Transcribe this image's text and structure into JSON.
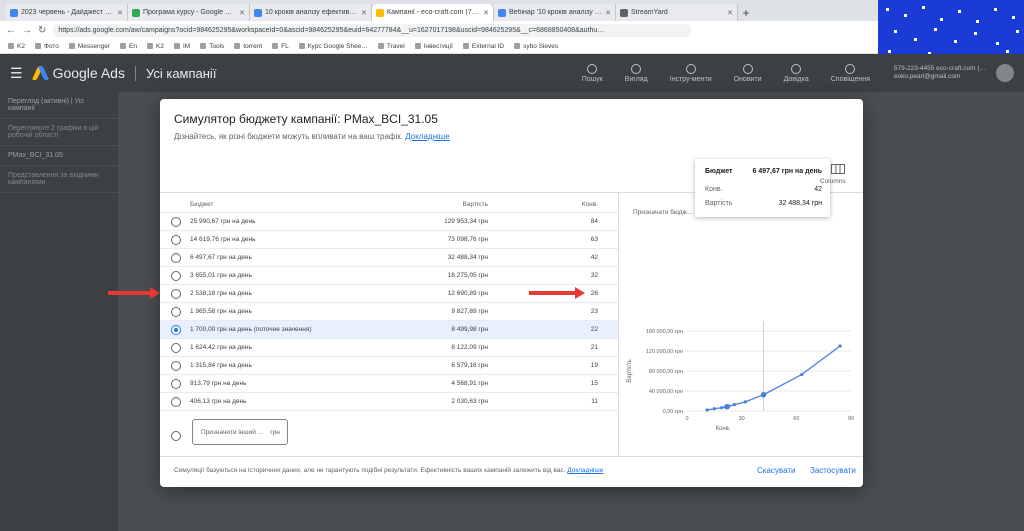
{
  "browser": {
    "tabs": [
      {
        "label": "2023 червень - Дайджест - …",
        "color": "#4285f4"
      },
      {
        "label": "Програма курсу - Google Di…",
        "color": "#34a853"
      },
      {
        "label": "10 кроків аналізу ефективно…",
        "color": "#4285f4"
      },
      {
        "label": "Кампанії - eco-craft.com (77…",
        "color": "#fbbc04"
      },
      {
        "label": "Вебінар '10 кроків аналізу е…",
        "color": "#4285f4"
      },
      {
        "label": "StreamYard",
        "color": "#5f6368"
      }
    ],
    "url": "https://ads.google.com/aw/campaigns?ocid=984625295&workspaceId=0&ascid=984625295&euid=64277784&__u=1627017198&uscid=984625295&__c=6868850408&authu…",
    "bookmarks": [
      "K2",
      "Фото",
      "Messenger",
      "En",
      "K2",
      "IM",
      "Tools",
      "torrent",
      "FL",
      "Курс Google Shee…",
      "Travel",
      "Інвестиції",
      "External ID",
      "sybo Sleves"
    ]
  },
  "ads": {
    "logo": "Google Ads",
    "crumb": "Усі кампанії",
    "tools": [
      "Пошук",
      "Вигляд",
      "Інстру-менти",
      "Оновити",
      "Довідка",
      "Сповіщення"
    ],
    "account": [
      "579-223-4455 eco-craft.com (…",
      "eoko.pearl@gmail.com"
    ],
    "side": [
      "Перегляд (активні) | Усі кампанії",
      "Перегляньте 2 графіки в цій робочій області",
      "PMax_BCI_31.05",
      "Представлення за вхідними кампаніями"
    ]
  },
  "modal": {
    "title": "Симулятор бюджету кампанії: PMax_BCI_31.05",
    "subtitle": "Дізнайтесь, як різні бюджети можуть впливати на ваш трафік.",
    "subtitle_link": "Докладніше",
    "headers": {
      "budget": "Бюджет",
      "cost": "Вартість",
      "conv": "Конв."
    },
    "rows": [
      {
        "budget": "25 990,67 грн на день",
        "cost": "129 953,34 грн",
        "conv": "84"
      },
      {
        "budget": "14 619,76 грн на день",
        "cost": "73 098,76 грн",
        "conv": "63"
      },
      {
        "budget": "6 497,67 грн на день",
        "cost": "32 488,34 грн",
        "conv": "42"
      },
      {
        "budget": "3 655,01 грн на день",
        "cost": "18 275,05 грн",
        "conv": "32"
      },
      {
        "budget": "2 538,18 грн на день",
        "cost": "12 690,89 грн",
        "conv": "26"
      },
      {
        "budget": "1 965,58 грн на день",
        "cost": "9 827,89 грн",
        "conv": "23"
      },
      {
        "budget": "1 700,00 грн на день (поточне значення)",
        "cost": "8 499,98 грн",
        "conv": "22",
        "selected": true
      },
      {
        "budget": "1 624,42 грн на день",
        "cost": "8 122,09 грн",
        "conv": "21"
      },
      {
        "budget": "1 315,84 грн на день",
        "cost": "6 579,16 грн",
        "conv": "19"
      },
      {
        "budget": "913,79 грн на день",
        "cost": "4 568,91 грн",
        "conv": "15"
      },
      {
        "budget": "406,13 грн на день",
        "cost": "2 030,63 грн",
        "conv": "11"
      }
    ],
    "custom_placeholder": "Призначити інший …",
    "custom_unit": "грн",
    "chart_label": "Призначати бюдж…",
    "columns_label": "Columns",
    "tooltip": {
      "title": "Бюджет",
      "title_value": "6 497,67 грн на день",
      "conv_label": "Конв.",
      "conv_value": "42",
      "cost_label": "Вартість",
      "cost_value": "32 488,34 грн"
    },
    "footer_note": "Симуляції базуються на історичних даних, але не гарантують подібні результати. Ефективність ваших кампаній залежить від вас.",
    "footer_link": "Докладніше",
    "cancel": "Скасувати",
    "apply": "Застосувати"
  },
  "chart_data": {
    "type": "line",
    "xlabel": "Конв.",
    "ylabel": "Вартість",
    "x_ticks": [
      "0",
      "30",
      "60",
      "90"
    ],
    "y_ticks": [
      "0,00 грн",
      "40 000,00 грн",
      "80 000,00 грн",
      "120 000,00 грн",
      "160 000,00 грн"
    ],
    "xlim": [
      0,
      90
    ],
    "ylim": [
      0,
      160000
    ],
    "x": [
      11,
      15,
      19,
      21,
      22,
      23,
      26,
      32,
      42,
      63,
      84
    ],
    "y": [
      2030.63,
      4568.91,
      6579.16,
      8122.09,
      8499.98,
      9827.89,
      12690.89,
      18275.05,
      32488.34,
      73098.76,
      129953.34
    ],
    "highlight": [
      22,
      42
    ],
    "color": "#4a7fe0"
  }
}
